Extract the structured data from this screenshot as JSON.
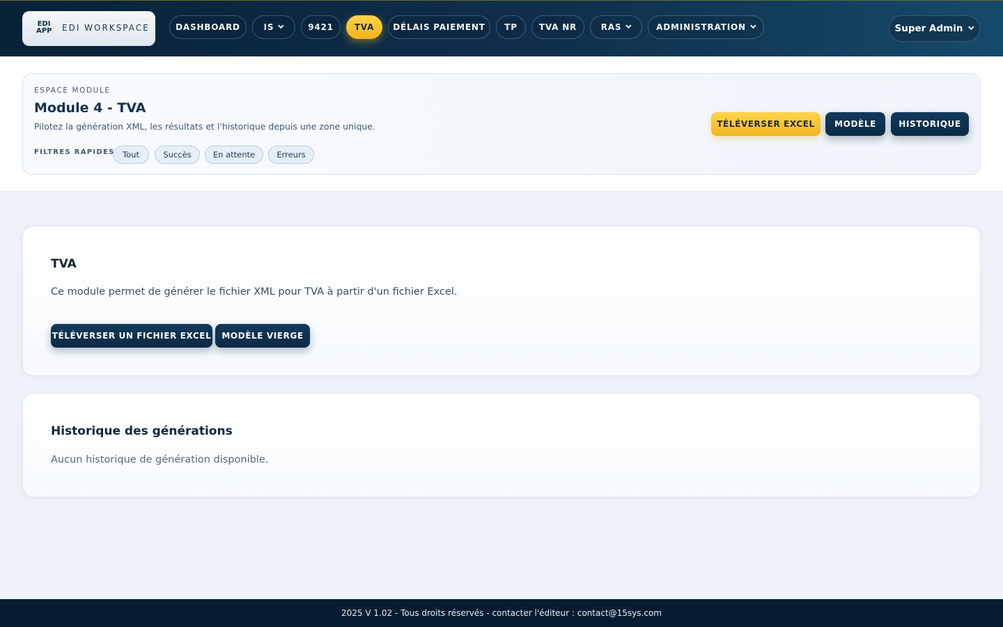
{
  "brand": {
    "logo_line1": "EDI",
    "logo_line2": "APP",
    "name": "EDI WORKSPACE"
  },
  "nav": {
    "items": [
      {
        "label": "DASHBOARD",
        "dropdown": false
      },
      {
        "label": "IS",
        "dropdown": true
      },
      {
        "label": "9421",
        "dropdown": false
      },
      {
        "label": "TVA",
        "dropdown": false,
        "active": true
      },
      {
        "label": "DÉLAIS PAIEMENT",
        "dropdown": false
      },
      {
        "label": "TP",
        "dropdown": false
      },
      {
        "label": "TVA NR",
        "dropdown": false
      },
      {
        "label": "RAS",
        "dropdown": true
      },
      {
        "label": "ADMINISTRATION",
        "dropdown": true
      }
    ],
    "user": "Super Admin"
  },
  "module": {
    "eyebrow": "ESPACE MODULE",
    "title": "Module 4 - TVA",
    "description": "Pilotez la génération XML, les résultats et l'historique depuis une zone unique.",
    "filters_label": "FILTRES RAPIDES",
    "filters": [
      "Tout",
      "Succès",
      "En attente",
      "Erreurs"
    ],
    "actions": {
      "upload": "TÉLÉVERSER EXCEL",
      "template": "MODÈLE",
      "history": "HISTORIQUE"
    }
  },
  "tva_card": {
    "title": "TVA",
    "text": "Ce module permet de générer le fichier XML pour TVA à partir d'un fichier Excel.",
    "upload_button": "TÉLÉVERSER UN FICHIER EXCEL",
    "blank_template_button": "MODÈLE VIERGE"
  },
  "history_card": {
    "title": "Historique des générations",
    "empty": "Aucun historique de génération disponible."
  },
  "footer": {
    "text": "2025 V 1.02 - Tous droits réservés - contacter l'éditeur : contact@15sys.com"
  },
  "colors": {
    "header_dark": "#0e2f4c",
    "accent_yellow": "#f8c22f",
    "button_dark": "#0d3150",
    "page_bg": "#eff3f9",
    "footer_bg": "#071c33"
  },
  "icons": {
    "dropdown": "chevron-down-icon"
  }
}
